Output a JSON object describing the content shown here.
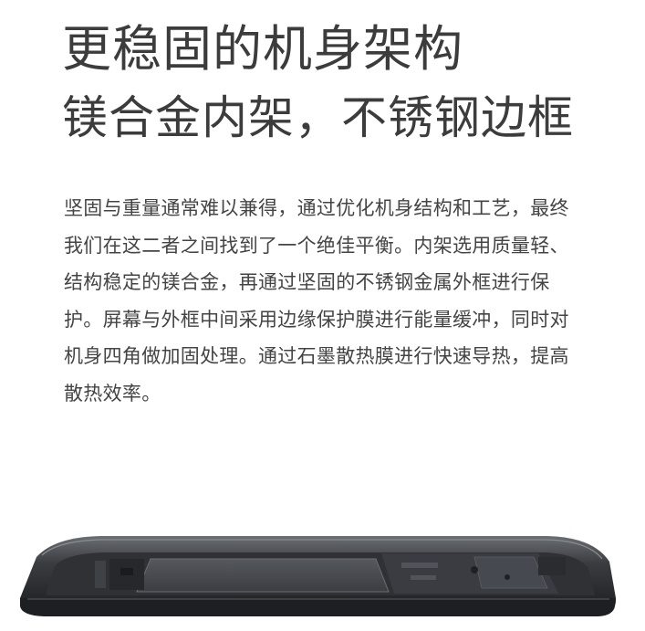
{
  "headline": {
    "line1": "更稳固的机身架构",
    "line2": "镁合金内架，不锈钢边框"
  },
  "body": {
    "paragraph": "坚固与重量通常难以兼得，通过优化机身结构和工艺，最终我们在这二者之间找到了一个绝佳平衡。内架选用质量轻、结构稳定的镁合金，再通过坚固的不锈钢金属外框进行保护。屏幕与外框中间采用边缘保护膜进行能量缓冲，同时对机身四角做加固处理。通过石墨散热膜进行快速导热，提高散热效率。"
  },
  "colors": {
    "text": "#444444",
    "heading": "#3c3c3c",
    "frame_dark": "#2a2c30",
    "frame_inner": "#4a4d52"
  }
}
